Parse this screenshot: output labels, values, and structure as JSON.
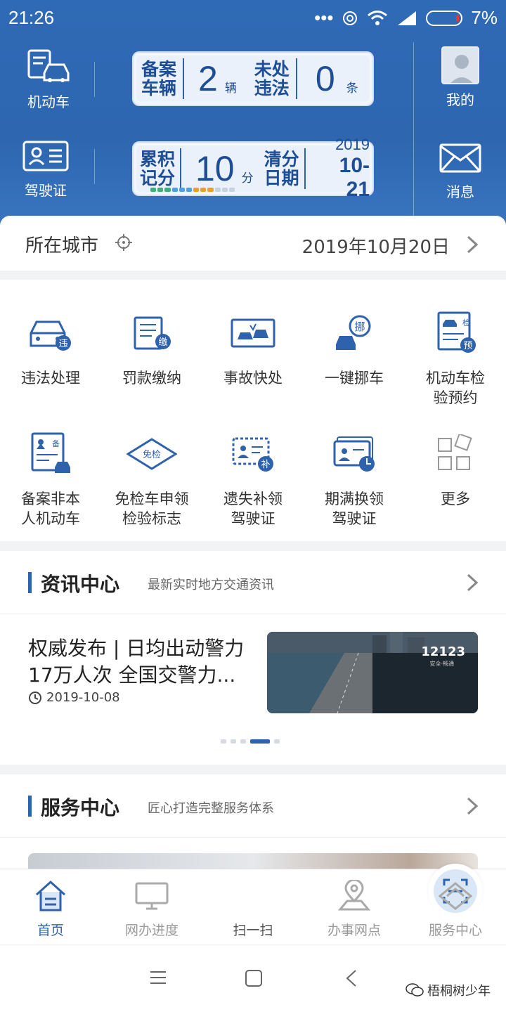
{
  "status": {
    "time": "21:26",
    "battery": "7%"
  },
  "header": {
    "vehicle_label": "机动车",
    "license_label": "驾驶证",
    "me_label": "我的",
    "msg_label": "消息",
    "card1": {
      "l1": "备案\n车辆",
      "num": "2",
      "unit": "辆",
      "l2": "未处\n违法",
      "num2": "0",
      "unit2": "条"
    },
    "card2": {
      "l1": "累积\n记分",
      "num": "10",
      "unit": "分",
      "l2": "清分\n日期",
      "year": "2019",
      "date": "10-21"
    }
  },
  "city": {
    "label": "所在城市",
    "date": "2019年10月20日"
  },
  "services": [
    {
      "label": "违法处理"
    },
    {
      "label": "罚款缴纳"
    },
    {
      "label": "事故快处"
    },
    {
      "label": "一键挪车"
    },
    {
      "label": "机动车检验预约"
    },
    {
      "label": "备案非本人机动车"
    },
    {
      "label": "免检车申领检验标志"
    },
    {
      "label": "遗失补领驾驶证"
    },
    {
      "label": "期满换领驾驶证"
    },
    {
      "label": "更多"
    }
  ],
  "news": {
    "title": "资讯中心",
    "sub": "最新实时地方交通资讯",
    "item_title": "权威发布 | 日均出动警力17万人次 全国交警力...",
    "item_date": "2019-10-08",
    "img_text": "12123",
    "img_sub": "安全·畅通"
  },
  "service_center": {
    "title": "服务中心",
    "sub": "匠心打造完整服务体系"
  },
  "tabs": [
    {
      "label": "首页"
    },
    {
      "label": "网办进度"
    },
    {
      "label": "扫一扫"
    },
    {
      "label": "办事网点"
    },
    {
      "label": "服务中心"
    }
  ],
  "watermark": "梧桐树少年",
  "colors": {
    "primary": "#2f62ad",
    "header_bg": "#2e66b0"
  }
}
